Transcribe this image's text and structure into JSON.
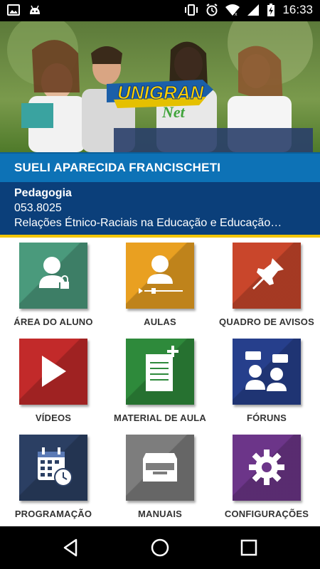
{
  "status": {
    "time": "16:33"
  },
  "header": {
    "logo_text": "UNIGRAN",
    "logo_sub": "Net",
    "student_name": "SUELI APARECIDA FRANCISCHETI",
    "course_name": "Pedagogia",
    "course_code": "053.8025",
    "subject": "Relações Étnico-Raciais na Educação e Educação…"
  },
  "menu": [
    {
      "label": "ÁREA DO ALUNO",
      "color": "#4a9a7c",
      "icon": "user-lock-icon"
    },
    {
      "label": "AULAS",
      "color": "#e9a021",
      "icon": "user-video-icon"
    },
    {
      "label": "QUADRO DE AVISOS",
      "color": "#c9462b",
      "icon": "pushpin-icon"
    },
    {
      "label": "VÍDEOS",
      "color": "#c22a2a",
      "icon": "play-icon"
    },
    {
      "label": "MATERIAL DE AULA",
      "color": "#2e8a3b",
      "icon": "document-add-icon"
    },
    {
      "label": "FÓRUNS",
      "color": "#263f8c",
      "icon": "forum-icon"
    },
    {
      "label": "PROGRAMAÇÃO",
      "color": "#2b3f63",
      "icon": "calendar-clock-icon"
    },
    {
      "label": "MANUAIS",
      "color": "#7d7d7d",
      "icon": "archive-tray-icon"
    },
    {
      "label": "CONFIGURAÇÕES",
      "color": "#6c3589",
      "icon": "gear-icon"
    }
  ]
}
